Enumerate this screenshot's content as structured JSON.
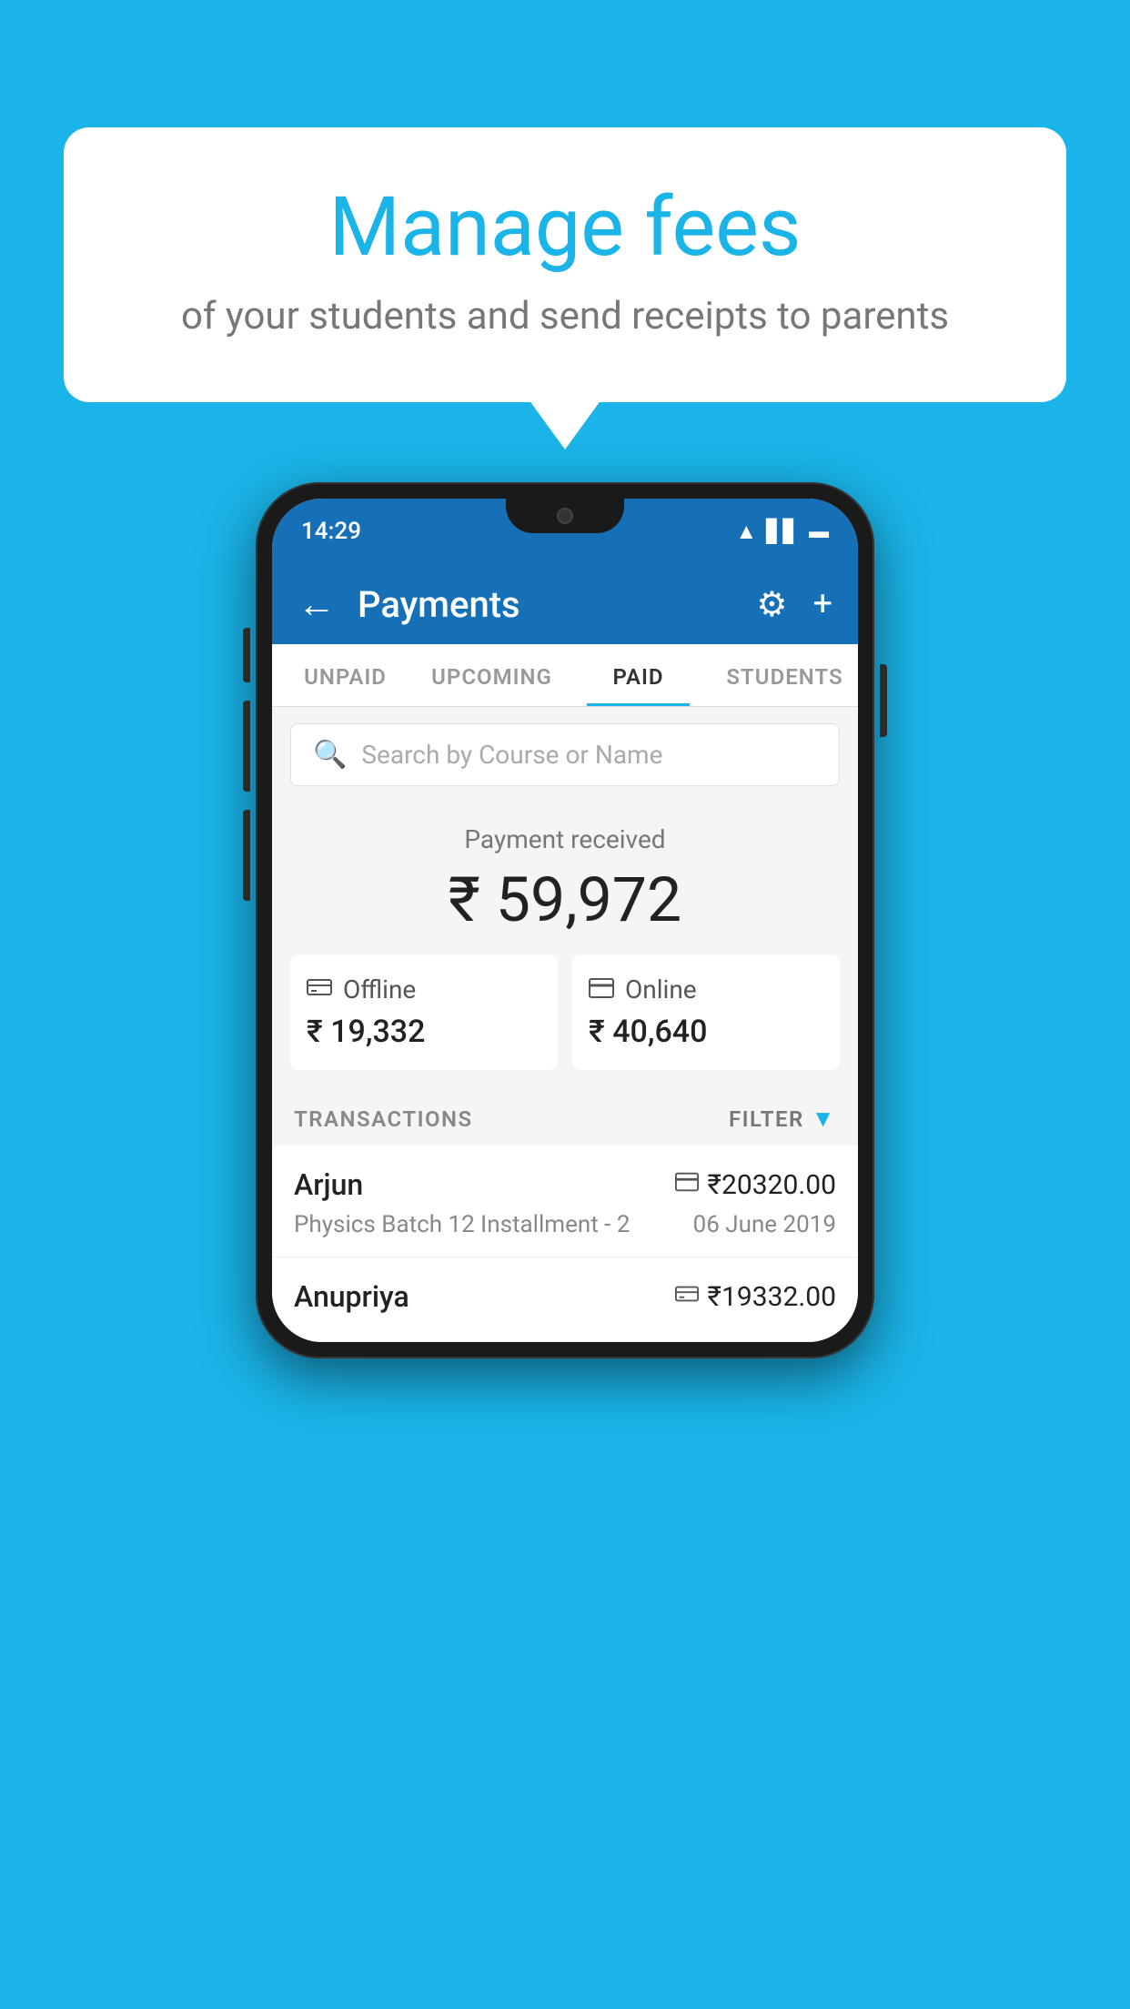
{
  "background_color": "#1ab4e8",
  "speech_bubble": {
    "title": "Manage fees",
    "subtitle": "of your students and send receipts to parents"
  },
  "phone": {
    "status_bar": {
      "time": "14:29"
    },
    "app_bar": {
      "title": "Payments",
      "back_icon": "←",
      "settings_icon": "⚙",
      "add_icon": "+"
    },
    "tabs": [
      {
        "label": "UNPAID",
        "active": false
      },
      {
        "label": "UPCOMING",
        "active": false
      },
      {
        "label": "PAID",
        "active": true
      },
      {
        "label": "STUDENTS",
        "active": false
      }
    ],
    "search": {
      "placeholder": "Search by Course or Name"
    },
    "payment_summary": {
      "label": "Payment received",
      "total_amount": "₹ 59,972",
      "offline": {
        "icon": "🪙",
        "label": "Offline",
        "amount": "₹ 19,332"
      },
      "online": {
        "icon": "💳",
        "label": "Online",
        "amount": "₹ 40,640"
      }
    },
    "transactions": {
      "header_label": "TRANSACTIONS",
      "filter_label": "FILTER",
      "items": [
        {
          "name": "Arjun",
          "course": "Physics Batch 12 Installment - 2",
          "amount": "₹20320.00",
          "date": "06 June 2019",
          "payment_type": "online"
        },
        {
          "name": "Anupriya",
          "amount": "₹19332.00",
          "payment_type": "offline"
        }
      ]
    }
  }
}
